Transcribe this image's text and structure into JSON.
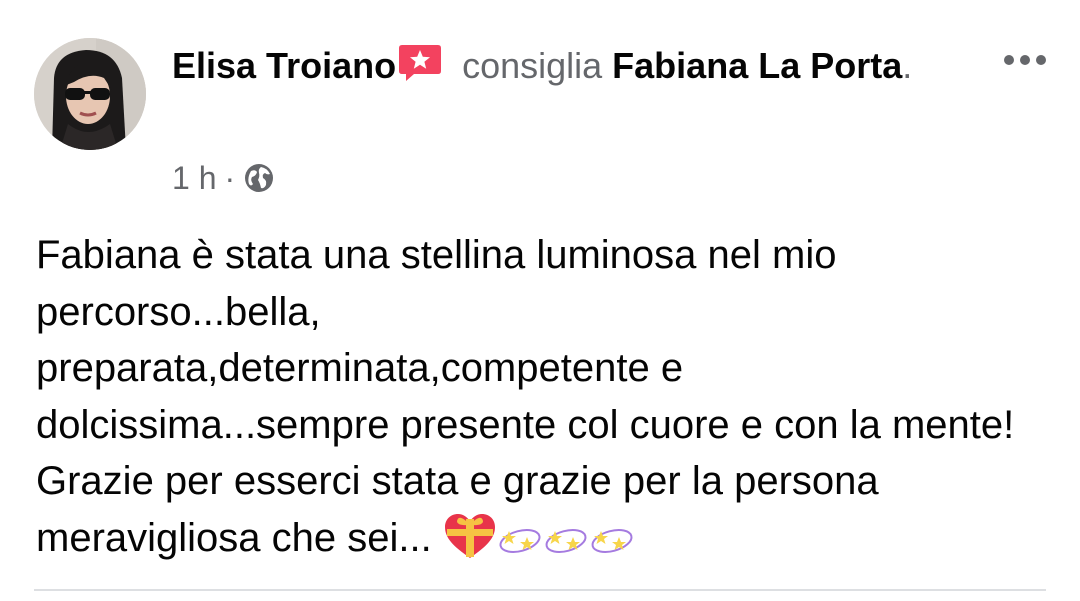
{
  "post": {
    "author_name": "Elisa Troiano",
    "verb": " consiglia ",
    "page_name": "Fabiana La Porta",
    "period": ".",
    "time": "1 h",
    "separator": "·",
    "privacy_icon": "globe-icon",
    "badge_icon": "recommend-badge-icon",
    "more_icon": "more-options-icon",
    "text": "Fabiana è stata una stellina luminosa nel mio percorso...bella,\npreparata,determinata,competente e dolcissima...sempre presente col cuore e con  la mente! Grazie per esserci stata e grazie per la persona meravigliosa che sei...",
    "emojis": [
      "gift-heart-emoji",
      "dizzy-stars-emoji",
      "dizzy-stars-emoji",
      "dizzy-stars-emoji"
    ]
  },
  "colors": {
    "text_primary": "#050505",
    "text_secondary": "#65676b",
    "badge": "#f3425f",
    "divider": "#dddfe2"
  }
}
